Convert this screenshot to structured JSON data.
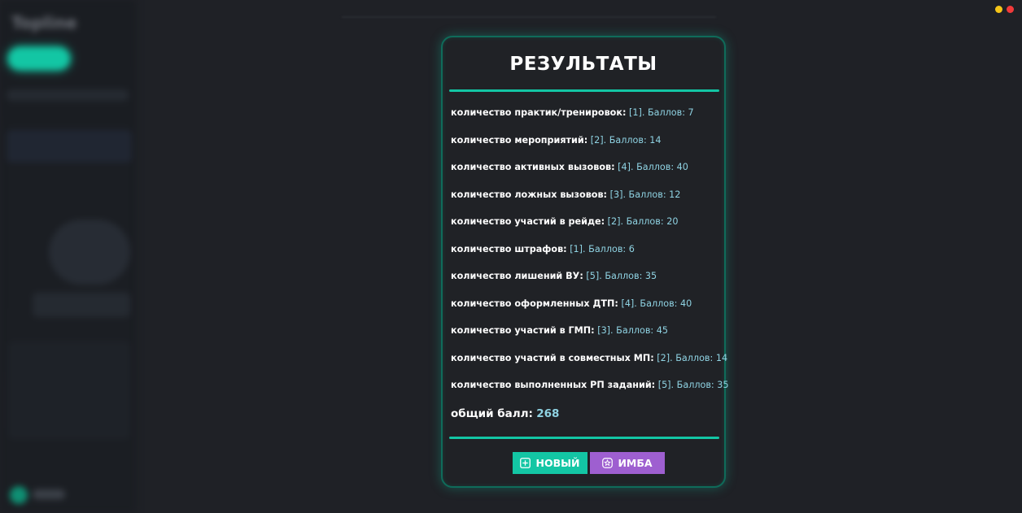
{
  "sidebar": {
    "brand": "Topline"
  },
  "modal": {
    "title": "РЕЗУЛЬТАТЫ",
    "rows": [
      {
        "label": "количество практик/тренировок:",
        "value": "[1]. Баллов: 7"
      },
      {
        "label": "количество мероприятий:",
        "value": "[2]. Баллов: 14"
      },
      {
        "label": "количество активных вызовов:",
        "value": "[4]. Баллов: 40"
      },
      {
        "label": "количество ложных вызовов:",
        "value": "[3]. Баллов: 12"
      },
      {
        "label": "количество участий в рейде:",
        "value": "[2]. Баллов: 20"
      },
      {
        "label": "количество штрафов:",
        "value": "[1]. Баллов: 6"
      },
      {
        "label": "количество лишений ВУ:",
        "value": "[5]. Баллов: 35"
      },
      {
        "label": "количество оформленных ДТП:",
        "value": "[4]. Баллов: 40"
      },
      {
        "label": "количество участий в ГМП:",
        "value": "[3]. Баллов: 45"
      },
      {
        "label": "количество участий в совместных МП:",
        "value": "[2]. Баллов: 14"
      },
      {
        "label": "количество выполненных РП заданий:",
        "value": "[5]. Баллов: 35"
      }
    ],
    "total": {
      "label": "общий балл:",
      "value": "268"
    },
    "buttons": {
      "new_label": "НОВЫЙ",
      "new_icon": "plus-square-icon",
      "imba_label": "ИМБА",
      "imba_icon": "star-badge-icon"
    }
  },
  "window_controls": [
    "minimize-dot",
    "close-dot"
  ],
  "colors": {
    "accent": "#13c6a4",
    "purple": "#9e5fd0",
    "value_text": "#8fd3e3",
    "background": "#1f2126"
  }
}
